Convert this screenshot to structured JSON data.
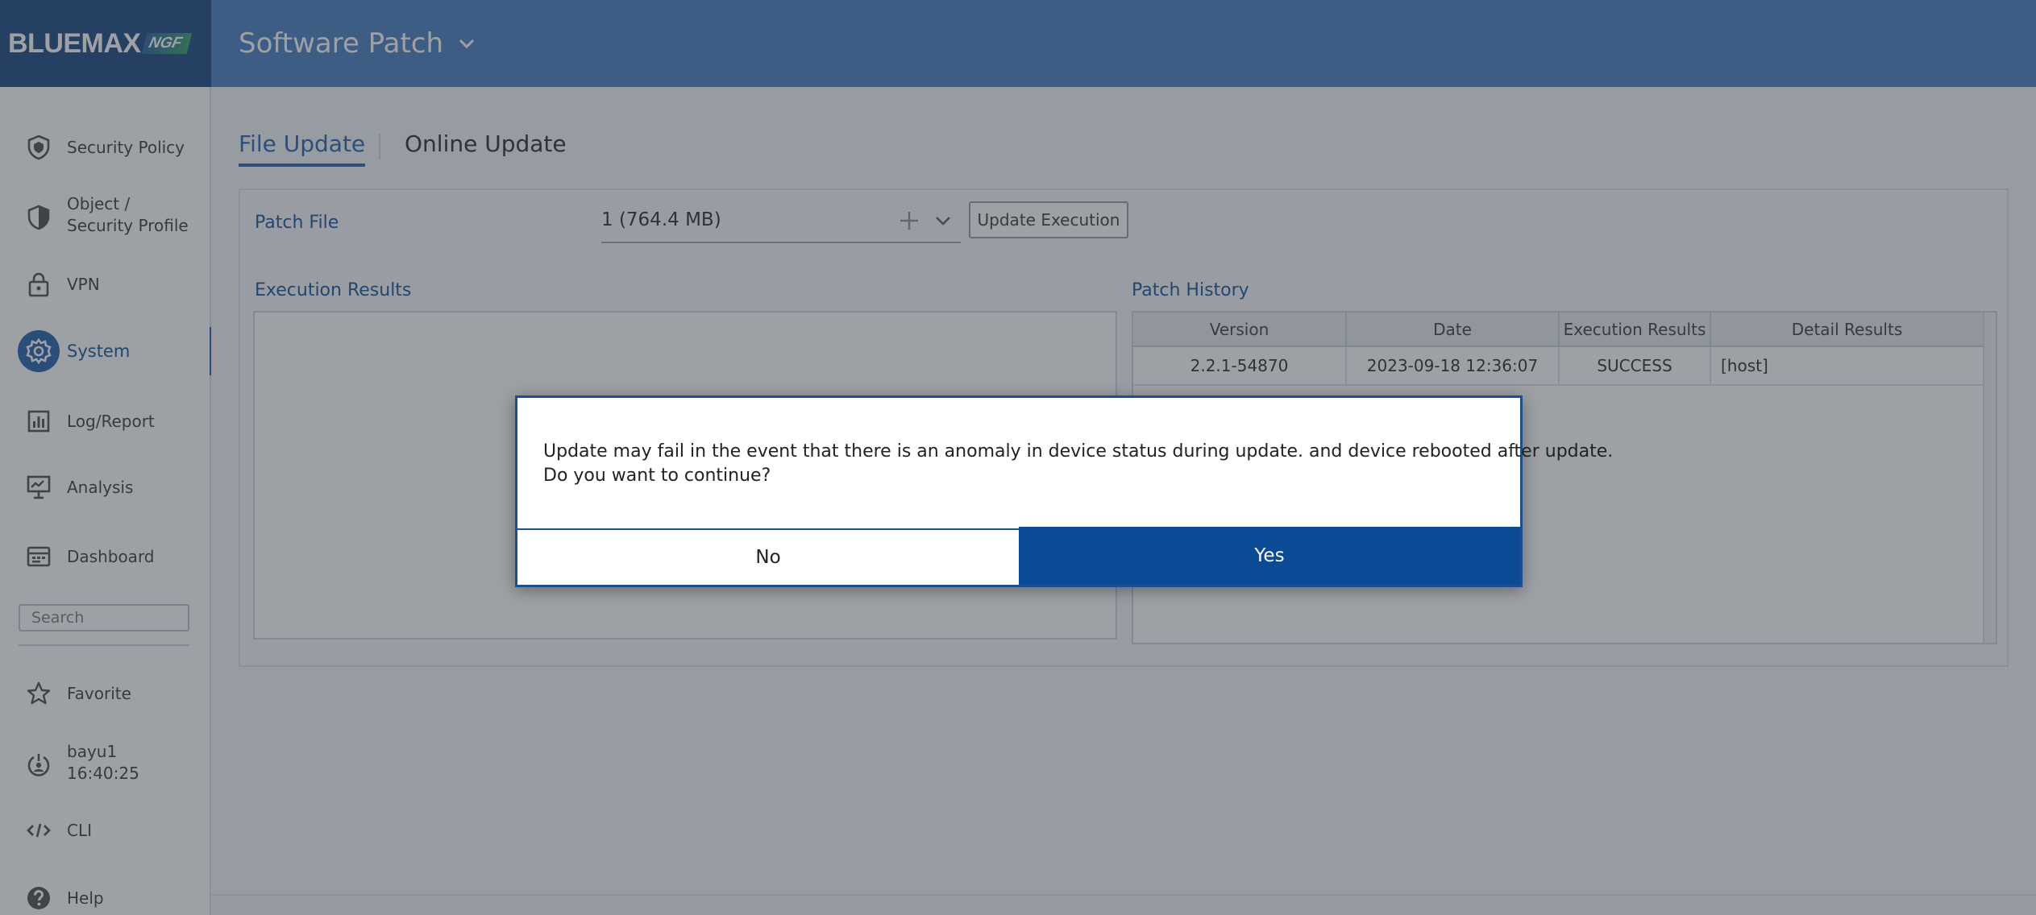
{
  "brand": {
    "name": "BLUEMAX",
    "badge": "NGF"
  },
  "header": {
    "title": "Software Patch",
    "dropdown_icon": "chevron-down-icon"
  },
  "sidebar": {
    "items": [
      {
        "label": "Security Policy",
        "icon": "shield-icon"
      },
      {
        "label_line1": "Object /",
        "label_line2": "Security Profile",
        "icon": "shield-half-icon"
      },
      {
        "label": "VPN",
        "icon": "lock-icon"
      },
      {
        "label": "System",
        "icon": "gear-icon",
        "active": true
      },
      {
        "label": "Log/Report",
        "icon": "bar-chart-icon"
      },
      {
        "label": "Analysis",
        "icon": "presentation-icon"
      },
      {
        "label": "Dashboard",
        "icon": "dashboard-icon"
      }
    ],
    "search_placeholder": "Search",
    "bottom_items": [
      {
        "label": "Favorite",
        "icon": "star-icon"
      },
      {
        "label_line1": "bayu1",
        "label_line2": "16:40:25",
        "icon": "user-power-icon"
      },
      {
        "label": "CLI",
        "icon": "code-icon"
      },
      {
        "label": "Help",
        "icon": "help-icon"
      }
    ]
  },
  "tabs": {
    "file_update": "File Update",
    "online_update": "Online Update"
  },
  "patch": {
    "label": "Patch File",
    "value": "1 (764.4 MB)",
    "update_button": "Update Execution"
  },
  "execution": {
    "label": "Execution Results"
  },
  "history": {
    "label": "Patch History",
    "columns": [
      "Version",
      "Date",
      "Execution Results",
      "Detail Results"
    ],
    "rows": [
      {
        "version": "2.2.1-54870",
        "date": "2023-09-18 12:36:07",
        "result": "SUCCESS",
        "detail": "[host]"
      }
    ]
  },
  "modal": {
    "line1": "Update may fail in the event that there is an anomaly in device status during update. and device rebooted after update.",
    "line2": "Do you want to continue?",
    "no_label": "No",
    "yes_label": "Yes"
  },
  "colors": {
    "header_blue": "#3e78c0",
    "logo_navy": "#0f3f7a",
    "accent": "#0b4a94"
  }
}
